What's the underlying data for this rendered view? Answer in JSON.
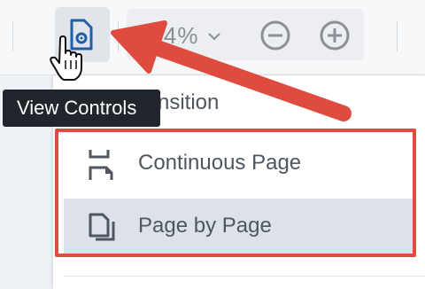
{
  "toolbar": {
    "view_controls_icon": "page-gear-icon",
    "zoom_value": "144%",
    "zoom_chevron_icon": "chevron-down-icon",
    "zoom_out_icon": "minus-circle-icon",
    "zoom_in_icon": "plus-circle-icon"
  },
  "tooltip": {
    "text": "View Controls"
  },
  "menu": {
    "partial_item_label": "nsition",
    "items": [
      {
        "label": "Continuous Page",
        "icon": "continuous-page-icon",
        "selected": false
      },
      {
        "label": "Page by Page",
        "icon": "page-by-page-icon",
        "selected": true
      }
    ]
  },
  "colors": {
    "annotation_red": "#e04b3f",
    "icon_blue": "#1f5fa8",
    "selected_bg": "#dde2ea",
    "tooltip_bg": "#20262c"
  }
}
